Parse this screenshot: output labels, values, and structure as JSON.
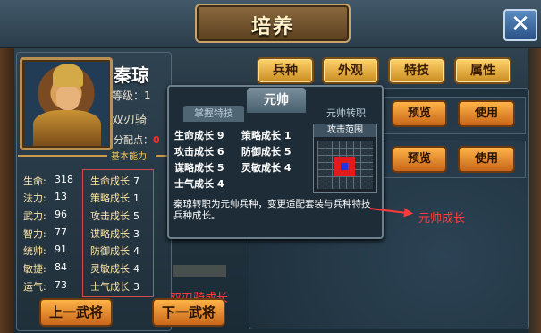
{
  "window": {
    "title": "培养",
    "close_label": "✕"
  },
  "hero": {
    "name": "秦琼",
    "level": "等级：1",
    "class": "双刃骑",
    "points_label": "分配点：",
    "points_value": "0"
  },
  "base_ability_label": "基本能力",
  "stats": [
    {
      "label": "生命:",
      "value": "318"
    },
    {
      "label": "法力:",
      "value": "13"
    },
    {
      "label": "武力:",
      "value": "96"
    },
    {
      "label": "智力:",
      "value": "77"
    },
    {
      "label": "统帅:",
      "value": "91"
    },
    {
      "label": "敏捷:",
      "value": "84"
    },
    {
      "label": "运气:",
      "value": "73"
    }
  ],
  "growth": [
    {
      "label": "生命成长",
      "value": "7"
    },
    {
      "label": "策略成长",
      "value": "1"
    },
    {
      "label": "攻击成长",
      "value": "5"
    },
    {
      "label": "谋略成长",
      "value": "3"
    },
    {
      "label": "防御成长",
      "value": "4"
    },
    {
      "label": "灵敏成长",
      "value": "4"
    },
    {
      "label": "士气成长",
      "value": "3"
    }
  ],
  "growth_caption": "双刃骑成长",
  "top_tabs": [
    "兵种",
    "外观",
    "特技",
    "属性"
  ],
  "right_rows": [
    {
      "preview": "预览",
      "use": "使用"
    },
    {
      "preview": "预览",
      "use": "使用"
    }
  ],
  "popup": {
    "title": "元帅",
    "tab_left": "掌握特技",
    "tab_right": "元帅转职",
    "growth": [
      {
        "label": "生命成长",
        "value": "9"
      },
      {
        "label": "策略成长",
        "value": "1"
      },
      {
        "label": "攻击成长",
        "value": "6"
      },
      {
        "label": "防御成长",
        "value": "5"
      },
      {
        "label": "谋略成长",
        "value": "5"
      },
      {
        "label": "灵敏成长",
        "value": "4"
      },
      {
        "label": "士气成长",
        "value": "4"
      }
    ],
    "attack_range_title": "攻击范围",
    "description": "秦琼转职为元帅兵种，变更适配套装与兵种特技兵种成长。"
  },
  "annotation": "元帅成长",
  "nav": {
    "prev": "上一武将",
    "next": "下一武将"
  },
  "colors": {
    "accent_red": "#ff3b3b",
    "gold": "#ffd46a",
    "panel": "#1f2f3a"
  }
}
